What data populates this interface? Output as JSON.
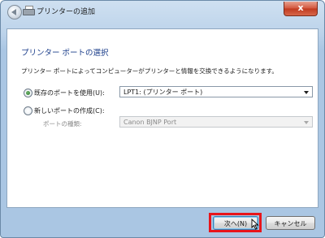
{
  "window": {
    "title": "プリンターの追加",
    "close_glyph": "x"
  },
  "heading": "プリンター ポートの選択",
  "description": "プリンター ポートによってコンピューターがプリンターと情報を交換できるようになります。",
  "options": {
    "existing_port": {
      "label": "既存のポートを使用(U):",
      "selected": true,
      "value": "LPT1: (プリンター ポート)"
    },
    "new_port": {
      "label": "新しいポートの作成(C):",
      "selected": false,
      "port_type_label": "ポートの種類:",
      "port_type_value": "Canon BJNP Port"
    }
  },
  "buttons": {
    "next": "次へ(N)",
    "cancel": "キャンセル"
  },
  "colors": {
    "heading": "#1a3d8a",
    "highlight": "#e8151b"
  }
}
